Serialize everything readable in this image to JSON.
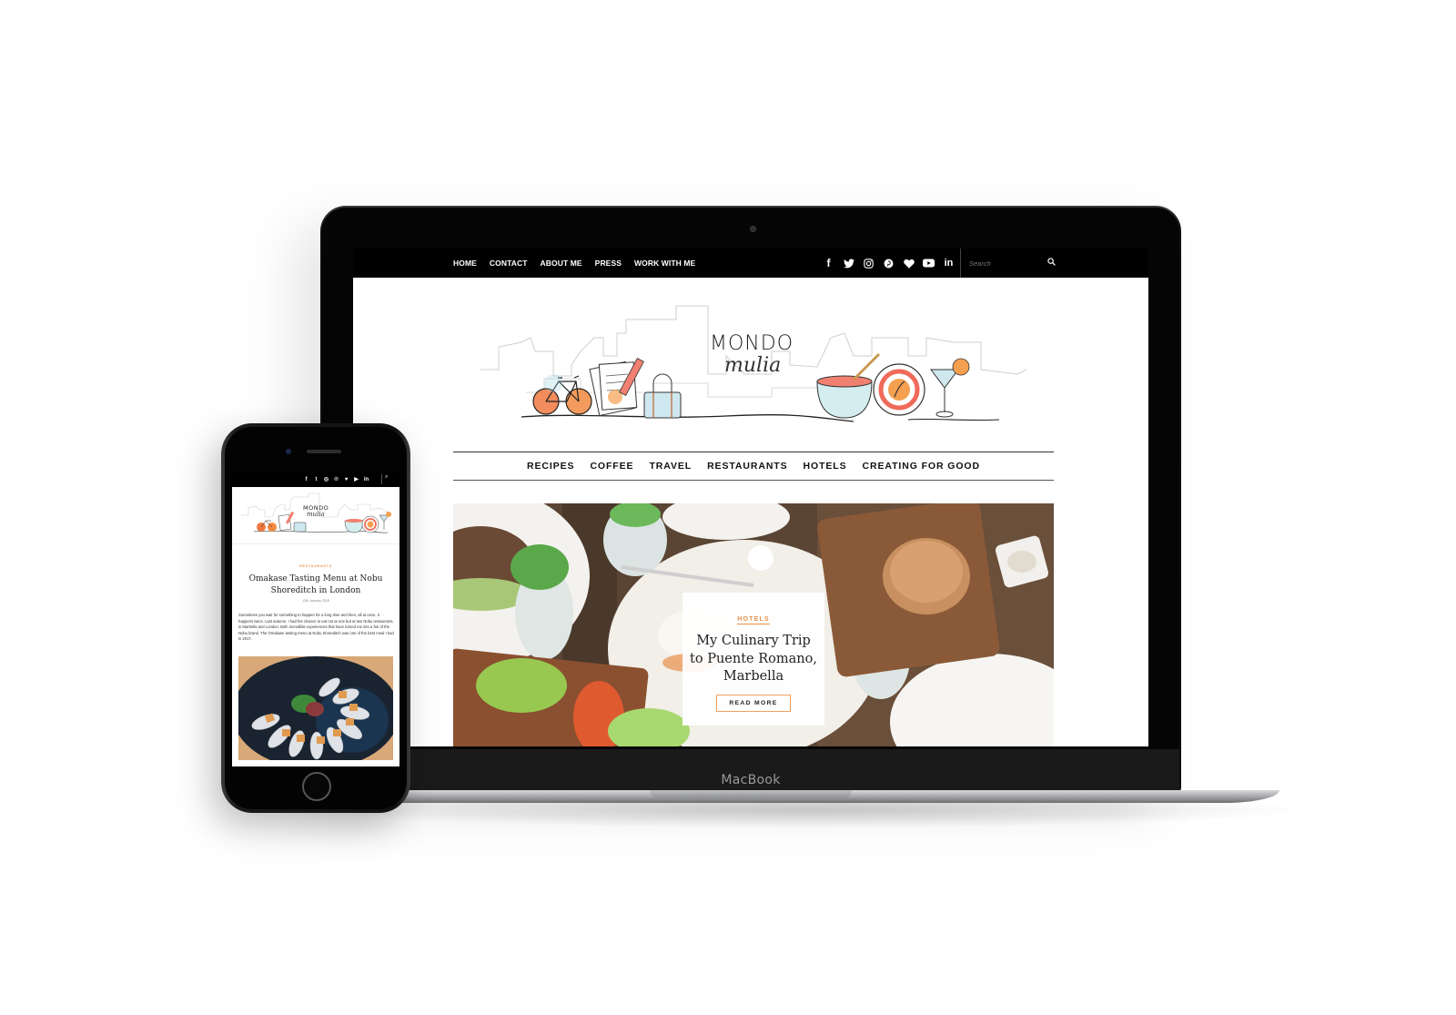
{
  "device": {
    "laptop_brand_label": "MacBook"
  },
  "desktop_site": {
    "top_nav": [
      {
        "label": "HOME"
      },
      {
        "label": "CONTACT"
      },
      {
        "label": "ABOUT ME"
      },
      {
        "label": "PRESS"
      },
      {
        "label": "WORK WITH ME"
      }
    ],
    "social_icons": [
      {
        "name": "facebook-icon",
        "glyph": "f"
      },
      {
        "name": "twitter-icon",
        "glyph": "🐦"
      },
      {
        "name": "instagram-icon",
        "glyph": "◎"
      },
      {
        "name": "pinterest-icon",
        "glyph": "℗"
      },
      {
        "name": "bloglovin-heart-icon",
        "glyph": "♥"
      },
      {
        "name": "youtube-icon",
        "glyph": "▶"
      },
      {
        "name": "linkedin-icon",
        "glyph": "in"
      }
    ],
    "search": {
      "placeholder": "Search",
      "icon": "search-icon",
      "icon_glyph": "⌕"
    },
    "logo": {
      "line1": "MONDO",
      "line2": "mulia"
    },
    "category_nav": [
      {
        "label": "RECIPES"
      },
      {
        "label": "COFFEE"
      },
      {
        "label": "TRAVEL"
      },
      {
        "label": "RESTAURANTS"
      },
      {
        "label": "HOTELS"
      },
      {
        "label": "CREATING FOR GOOD"
      }
    ],
    "featured_post": {
      "category": "HOTELS",
      "title": "My Culinary Trip to Puente Romano, Marbella",
      "button_label": "READ MORE"
    },
    "colors": {
      "accent": "#e8904a",
      "topbar_bg": "#000000",
      "text": "#111111"
    }
  },
  "mobile_site": {
    "social_icons": [
      {
        "name": "facebook-icon",
        "glyph": "f"
      },
      {
        "name": "twitter-icon",
        "glyph": "t"
      },
      {
        "name": "instagram-icon",
        "glyph": "◎"
      },
      {
        "name": "pinterest-icon",
        "glyph": "℗"
      },
      {
        "name": "bloglovin-heart-icon",
        "glyph": "♥"
      },
      {
        "name": "youtube-icon",
        "glyph": "▶"
      },
      {
        "name": "linkedin-icon",
        "glyph": "in"
      }
    ],
    "search_icon_glyph": "⌕",
    "logo": {
      "line1": "MONDO",
      "line2": "mulia"
    },
    "post": {
      "category": "RESTAURANTS",
      "title": "Omakase Tasting Menu at Nobu Shoreditch in London",
      "date": "12th January 2018",
      "excerpt": "Sometimes you wait for something to happen for a long time and then, all at once, it happens twice. Last autumn, I had the chance to eat not at one but at two Nobu restaurants, in Marbella and London. Both incredible experiences that have turned me into a fan of the Nobu brand. The Omakase tasting menu at Nobu Shoreditch was one of the best meal I had in 2017."
    }
  }
}
